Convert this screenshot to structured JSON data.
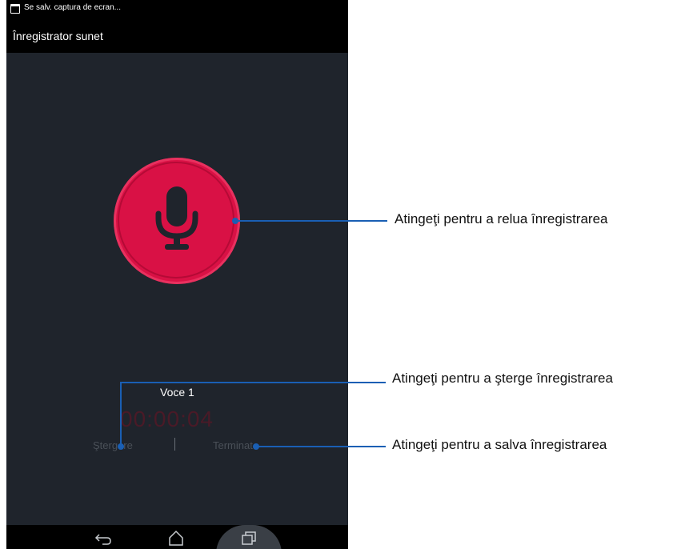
{
  "status_bar": {
    "notification_text": "Se salv. captura de ecran...",
    "icon": "screenshot-icon"
  },
  "app_bar": {
    "title": "Înregistrator sunet"
  },
  "recorder": {
    "record_button_icon": "microphone-icon",
    "recording_name": "Voce 1",
    "timer": "00:00:04",
    "delete_label": "Ştergere",
    "finish_label": "Terminat",
    "accent_color": "#d91145"
  },
  "nav_bar": {
    "back_icon": "back-icon",
    "home_icon": "home-icon",
    "recent_icon": "recent-apps-icon"
  },
  "annotations": {
    "rerecord": "Atingeţi pentru a relua înregistrarea",
    "delete": "Atingeţi pentru a şterge înregistrarea",
    "save": "Atingeţi pentru a salva înregistrarea",
    "line_color": "#1a5fb4"
  }
}
